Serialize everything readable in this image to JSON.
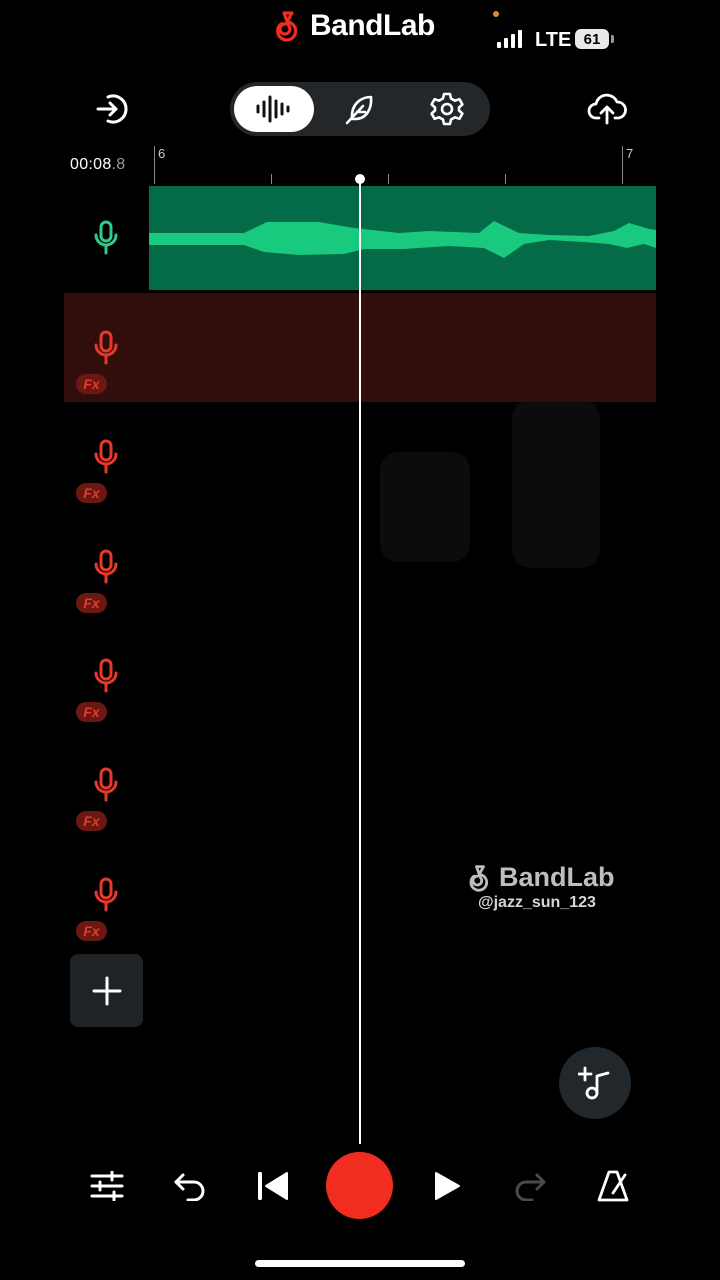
{
  "status_bar": {
    "brand": "BandLab",
    "network": "LTE",
    "battery": "61"
  },
  "toolbar": {
    "back_icon": "exit-arrow-icon",
    "segments": [
      "waveform-icon",
      "feather-icon",
      "gear-icon"
    ],
    "active_segment": "waveform-icon",
    "upload_icon": "cloud-upload-icon"
  },
  "ruler": {
    "time_main": "00:08",
    "time_frac": ".8",
    "bar_start": "6",
    "bar_end": "7"
  },
  "tracks": [
    {
      "state": "selected",
      "color": "#2ecc8a",
      "fx": false
    },
    {
      "state": "armed",
      "color": "#e8382b",
      "fx": true,
      "fx_label": "Fx"
    },
    {
      "state": "normal",
      "color": "#e8382b",
      "fx": true,
      "fx_label": "Fx"
    },
    {
      "state": "normal",
      "color": "#e8382b",
      "fx": true,
      "fx_label": "Fx"
    },
    {
      "state": "normal",
      "color": "#e8382b",
      "fx": true,
      "fx_label": "Fx"
    },
    {
      "state": "normal",
      "color": "#e8382b",
      "fx": true,
      "fx_label": "Fx"
    },
    {
      "state": "normal",
      "color": "#e8382b",
      "fx": true,
      "fx_label": "Fx"
    }
  ],
  "watermark": {
    "brand": "BandLab",
    "handle": "@jazz_sun_123"
  },
  "colors": {
    "accent_red": "#f02d1f",
    "track_green": "#046b49",
    "wave_green": "#19c97e",
    "track_red_bg": "#310e0b"
  },
  "transport": {
    "icons": [
      "mixer-sliders-icon",
      "undo-icon",
      "skip-to-start-icon",
      "record-button",
      "play-icon",
      "redo-icon",
      "metronome-icon"
    ]
  }
}
